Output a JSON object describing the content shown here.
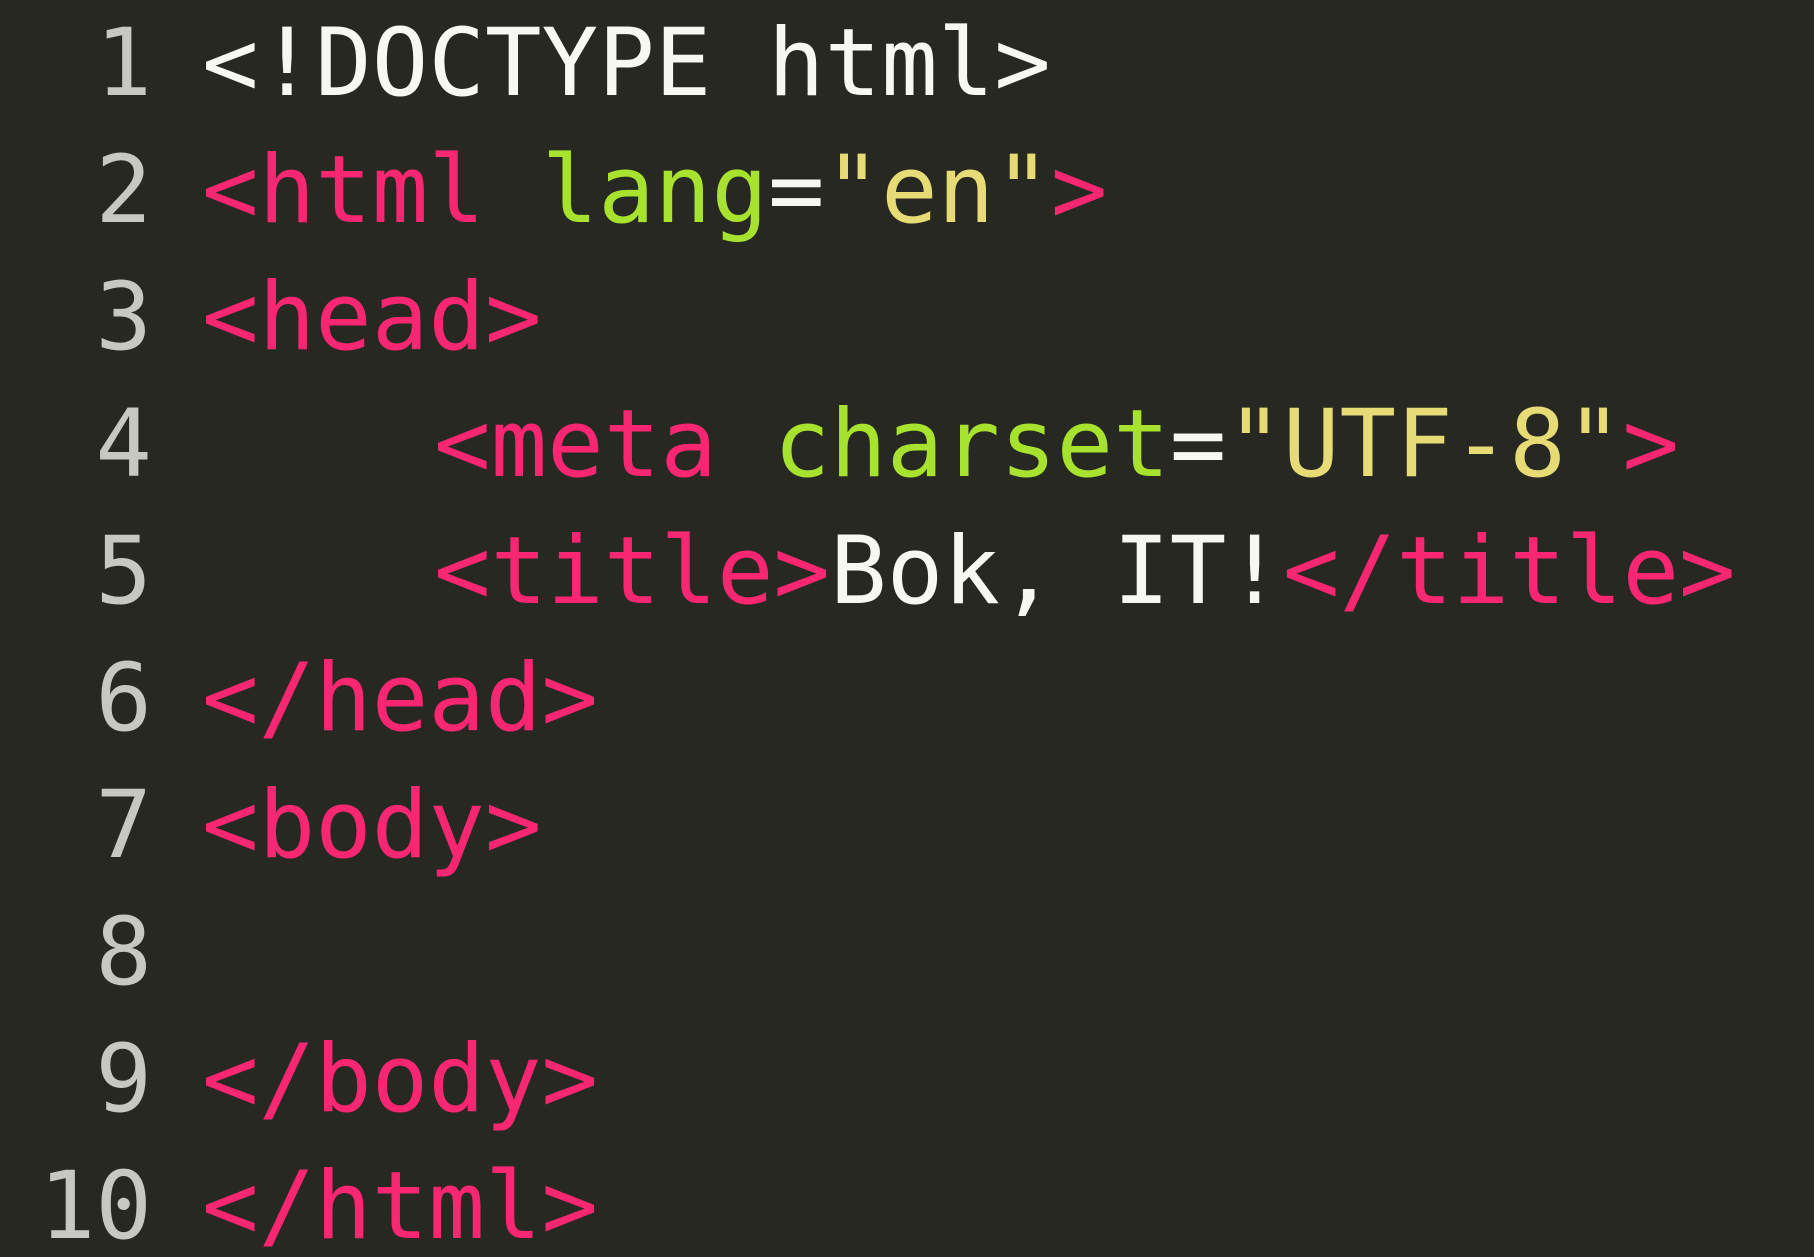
{
  "colors": {
    "background": "#272822",
    "line_number": "#c8c8c2",
    "plain_text": "#f8f8f2",
    "tag": "#f92672",
    "attribute": "#a6e22e",
    "string": "#e6db74"
  },
  "lines": [
    {
      "number": "1",
      "tokens": [
        "<!DOCTYPE html>"
      ]
    },
    {
      "number": "2",
      "tokens": [
        "<html",
        " ",
        "lang",
        "=",
        "\"en\"",
        ">"
      ]
    },
    {
      "number": "3",
      "tokens": [
        "<head>"
      ]
    },
    {
      "number": "4",
      "tokens": [
        "<meta",
        " ",
        "charset",
        "=",
        "\"UTF-8\"",
        ">"
      ]
    },
    {
      "number": "5",
      "tokens": [
        "<title>",
        "Bok, IT!",
        "</title>"
      ]
    },
    {
      "number": "6",
      "tokens": [
        "</head>"
      ]
    },
    {
      "number": "7",
      "tokens": [
        "<body>"
      ]
    },
    {
      "number": "8",
      "tokens": []
    },
    {
      "number": "9",
      "tokens": [
        "</body>"
      ]
    },
    {
      "number": "10",
      "tokens": [
        "</html>"
      ]
    }
  ]
}
